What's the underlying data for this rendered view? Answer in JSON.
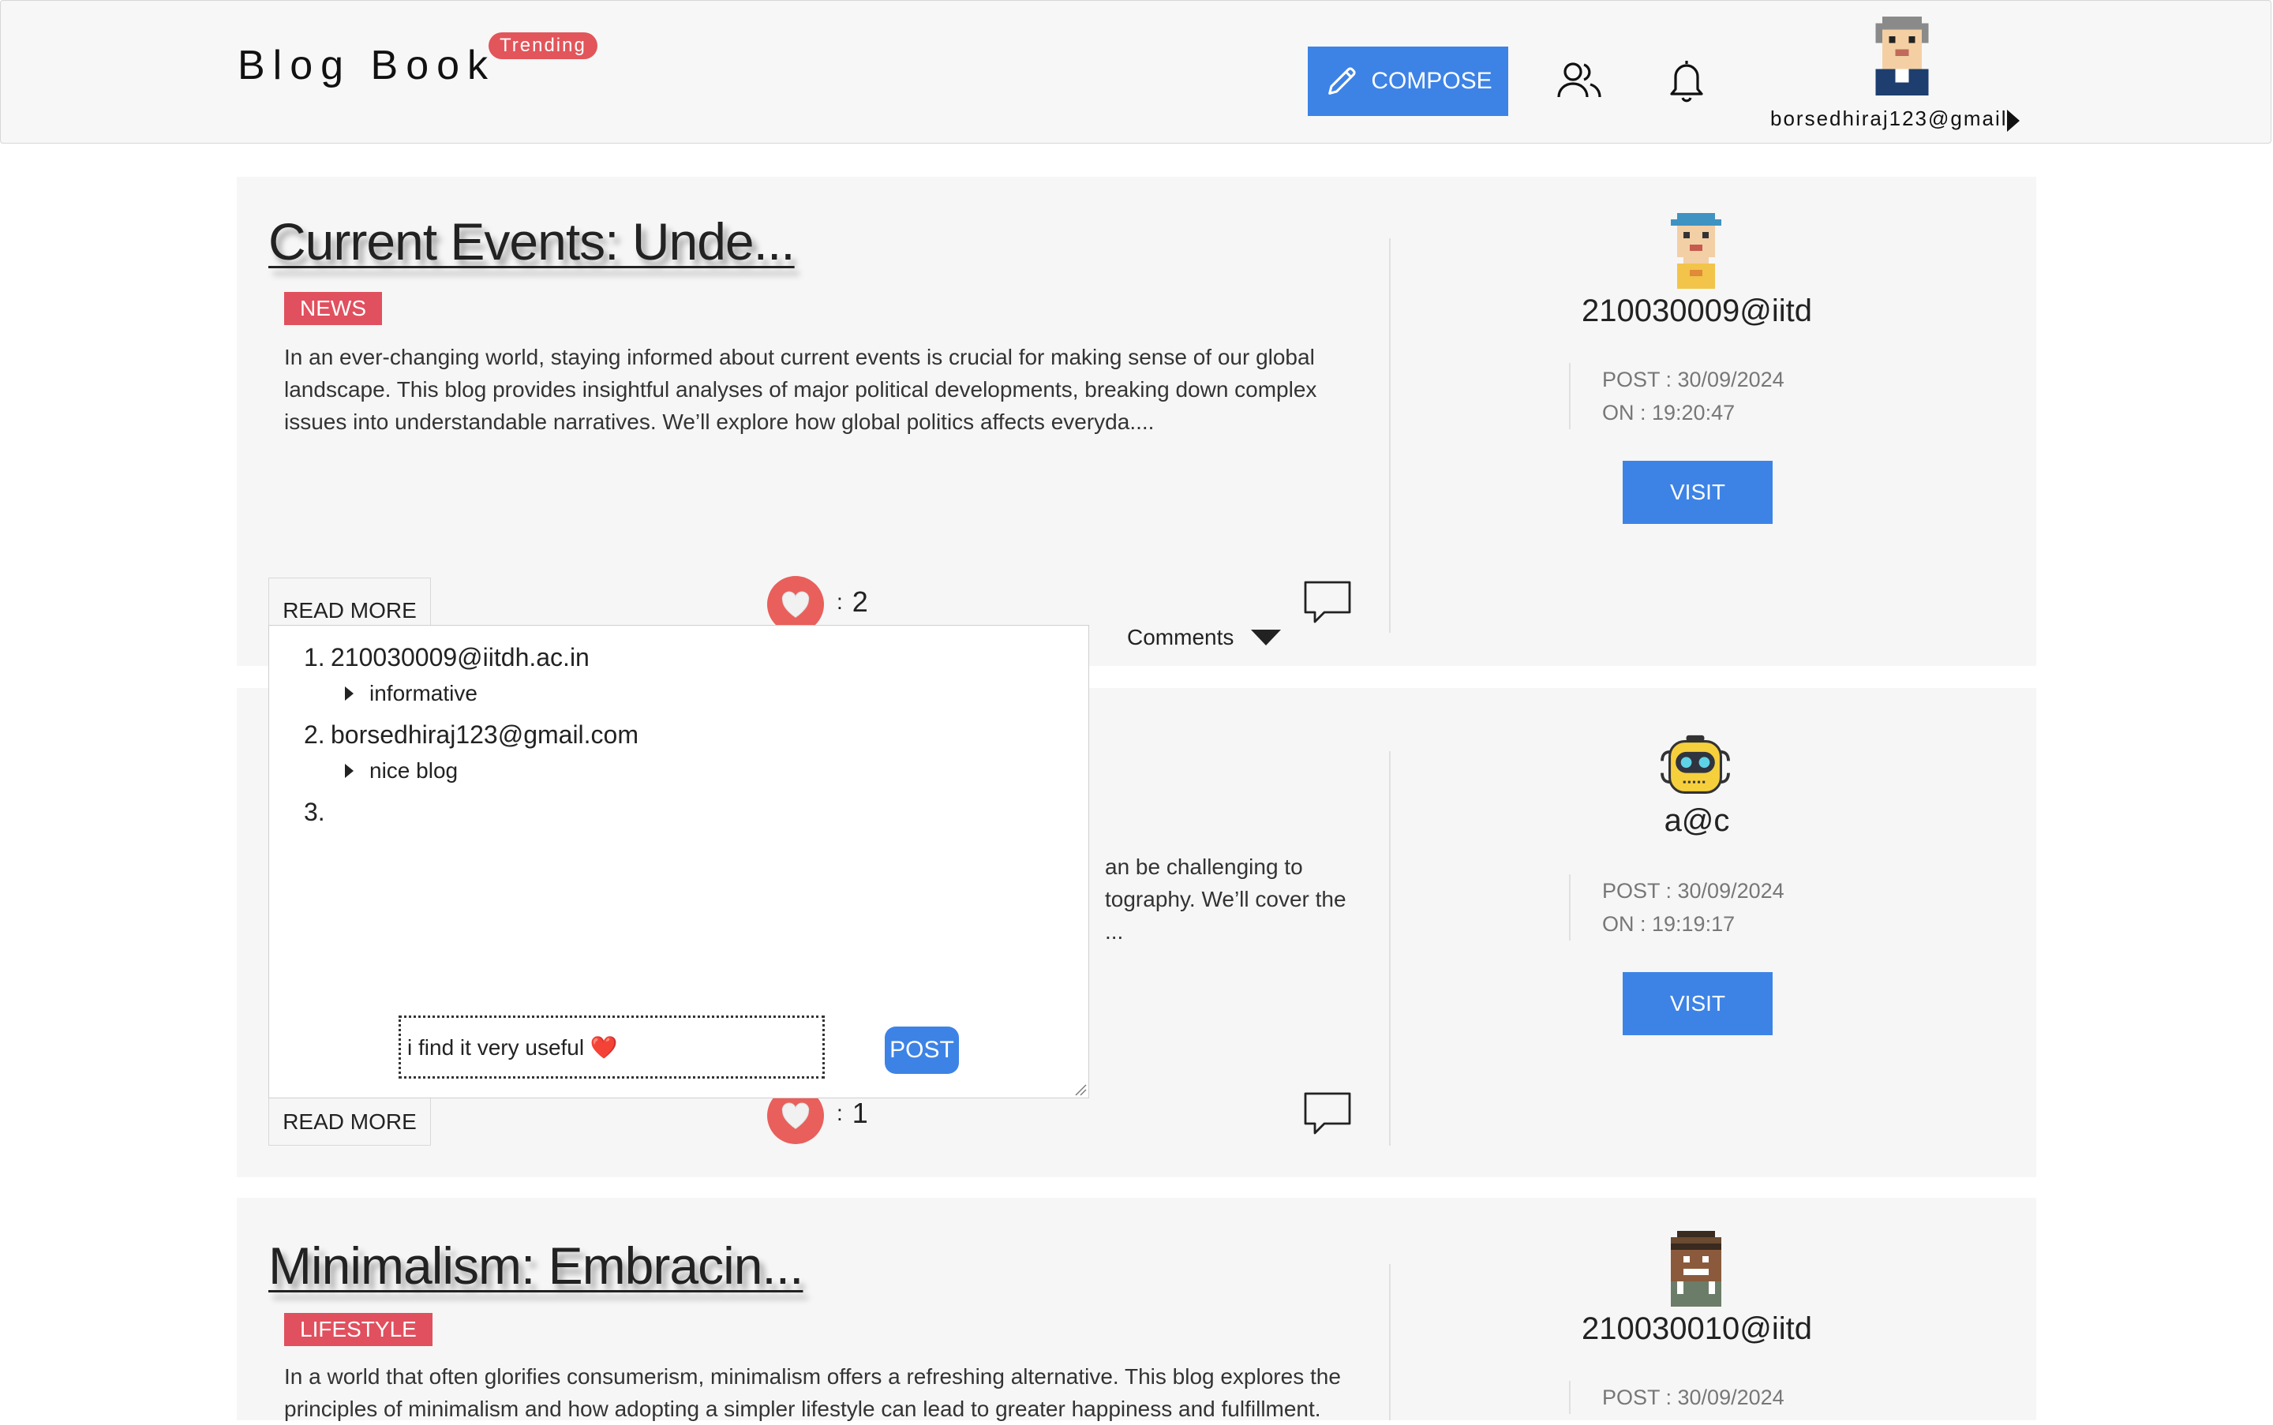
{
  "header": {
    "logo": "Blog Book",
    "trending_badge": "Trending",
    "compose_label": "COMPOSE",
    "user_label": "borsedhiraj123@gmail"
  },
  "posts": [
    {
      "title": "Current Events: Unde...",
      "tag": "NEWS",
      "excerpt": "In an ever-changing world, staying informed about current events is crucial for making sense of our global landscape. This blog provides insightful analyses of major political developments, breaking down complex issues into understandable narratives. We’ll explore how global politics affects everyda....",
      "read_more": "READ MORE",
      "like_colon": ":",
      "likes": "2",
      "comments_label": "Comments",
      "author": "210030009@iitd",
      "post_date": "POST : 30/09/2024",
      "post_time": "ON : 19:20:47",
      "visit": "VISIT"
    },
    {
      "title": "",
      "tag": "",
      "excerpt_visible": [
        "an be challenging to",
        "tography. We’ll cover the",
        "..."
      ],
      "read_more": "READ MORE",
      "like_colon": ":",
      "likes": "1",
      "author": "a@c",
      "post_date": "POST : 30/09/2024",
      "post_time": "ON : 19:19:17",
      "visit": "VISIT"
    },
    {
      "title": "Minimalism: Embracin...",
      "tag": "LIFESTYLE",
      "excerpt": "In a world that often glorifies consumerism, minimalism offers a refreshing alternative. This blog explores the principles of minimalism and how adopting a simpler lifestyle can lead to greater happiness and fulfillment.",
      "author": "210030010@iitd",
      "post_date": "POST : 30/09/2024"
    }
  ],
  "comments_popup": {
    "items": [
      {
        "num": "1.",
        "user": "210030009@iitdh.ac.in",
        "text": "informative"
      },
      {
        "num": "2.",
        "user": "borsedhiraj123@gmail.com",
        "text": "nice blog"
      },
      {
        "num": "3.",
        "user": "",
        "text": ""
      }
    ],
    "input_value": "i find it very useful ❤️",
    "post_button": "POST"
  },
  "colors": {
    "accent_blue": "#3d83e6",
    "tag_red": "#e0505e",
    "like_red": "#e95f5c",
    "card_bg": "#f6f6f6"
  }
}
